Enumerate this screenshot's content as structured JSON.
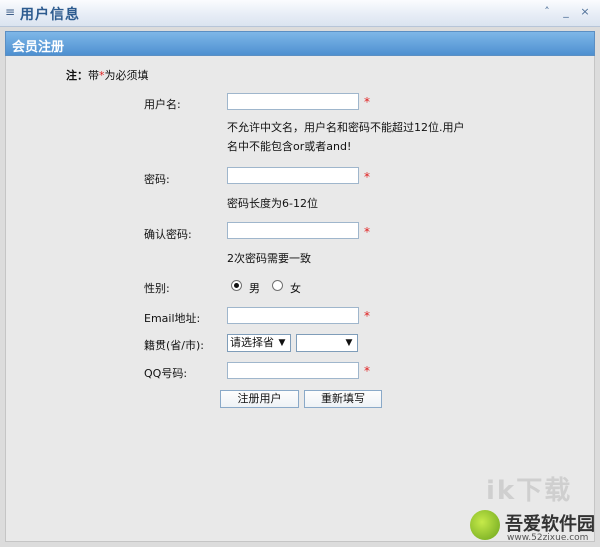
{
  "window": {
    "title": "用户信息",
    "menu_glyph": "≡",
    "controls": [
      "˄",
      "_",
      "×"
    ]
  },
  "form": {
    "section_title": "会员注册",
    "note_prefix": "注：",
    "note_body_1": "带",
    "note_star": "*",
    "note_body_2": "为必须填",
    "required_mark": "*",
    "username_label": "用户名:",
    "username_hint": "不允许中文名，用户名和密码不能超过12位.用户名中不能包含or或者and!",
    "password_label": "密码:",
    "password_hint": "密码长度为6-12位",
    "confirm_label": "确认密码:",
    "confirm_hint": "2次密码需要一致",
    "gender_label": "性别:",
    "gender_male": "男",
    "gender_female": "女",
    "email_label": "Email地址:",
    "hometown_label": "籍贯(省/市):",
    "province_selected": "请选择省",
    "city_selected": "",
    "qq_label": "QQ号码:",
    "register_button": "注册用户",
    "reset_button": "重新填写"
  },
  "watermark": {
    "ghost": "ik下载",
    "brand": "吾爱软件园",
    "url": "www.52zixue.com"
  }
}
